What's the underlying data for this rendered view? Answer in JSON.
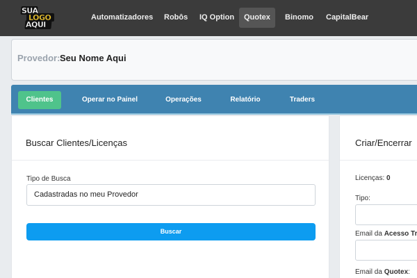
{
  "logo": {
    "line1": "SUA",
    "line2": "LOGO",
    "line3": "AQUI"
  },
  "nav": {
    "items": [
      {
        "label": "Automatizadores"
      },
      {
        "label": "Robôs"
      },
      {
        "label": "IQ Option"
      },
      {
        "label": "Quotex",
        "active": true
      },
      {
        "label": "Binomo"
      },
      {
        "label": "CapitalBear"
      }
    ]
  },
  "provider": {
    "label": "Provedor:",
    "value": "Seu Nome Aqui"
  },
  "tabs": [
    {
      "label": "Clientes",
      "active": true
    },
    {
      "label": "Operar no Painel"
    },
    {
      "label": "Operações"
    },
    {
      "label": "Relatório"
    },
    {
      "label": "Traders"
    }
  ],
  "search_card": {
    "title": "Buscar Clientes/Licenças",
    "search_type_label": "Tipo de Busca",
    "search_type_value": "Cadastradas no meu Provedor",
    "button_label": "Buscar"
  },
  "create_card": {
    "title": "Criar/Encerrar",
    "licenses_label": "Licenças:",
    "licenses_value": "0",
    "type_label": "Tipo:",
    "email_access_label_prefix": "Email da",
    "email_access_label_bold": "Acesso Tr",
    "email_quotex_label_prefix": "Email da",
    "email_quotex_label_bold": "Quotex",
    "email_quotex_label_suffix": ":"
  },
  "colors": {
    "topbar": "#3b3b3b",
    "tabbar": "#3f83b0",
    "active_tab": "#4fc38b",
    "primary_button": "#0d9cf0"
  }
}
